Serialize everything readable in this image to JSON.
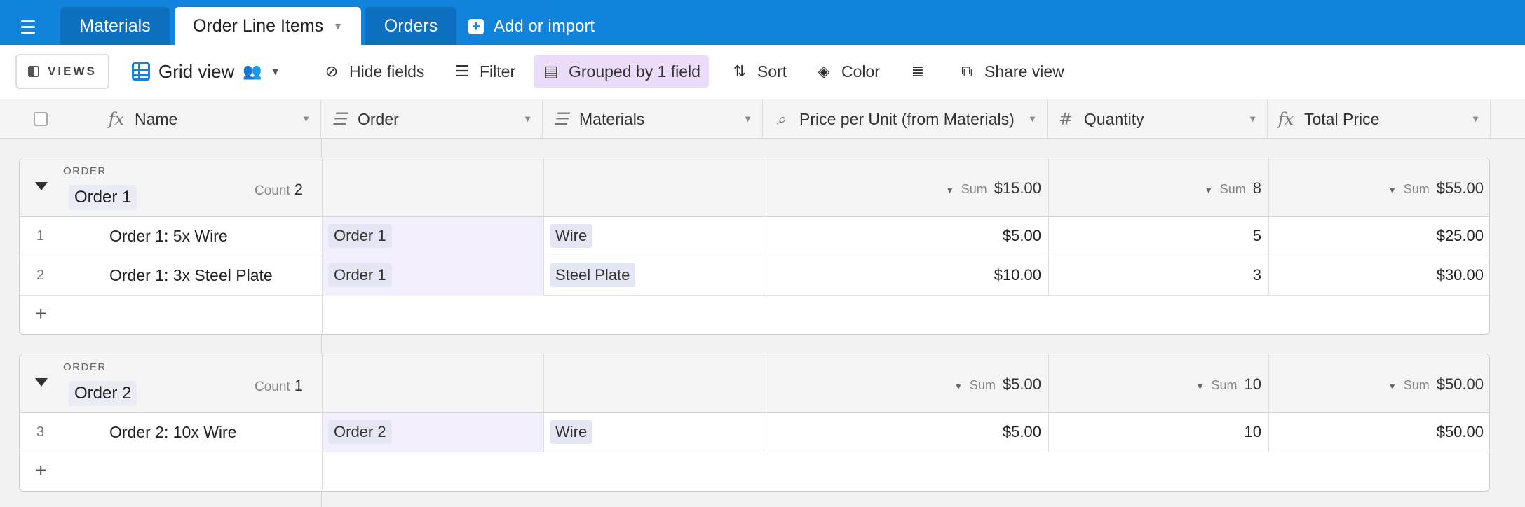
{
  "tabs": [
    {
      "label": "Materials",
      "active": false
    },
    {
      "label": "Order Line Items",
      "active": true
    },
    {
      "label": "Orders",
      "active": false
    }
  ],
  "add_import_label": "Add or import",
  "toolbar": {
    "views_label": "VIEWS",
    "view_name": "Grid view",
    "hide_fields": "Hide fields",
    "filter": "Filter",
    "grouped": "Grouped by 1 field",
    "sort": "Sort",
    "color": "Color",
    "share_view": "Share view"
  },
  "columns": [
    {
      "name": "Name",
      "icon": "formula-icon"
    },
    {
      "name": "Order",
      "icon": "link-field-icon"
    },
    {
      "name": "Materials",
      "icon": "link-field-icon"
    },
    {
      "name": "Price per Unit (from Materials)",
      "icon": "lookup-icon"
    },
    {
      "name": "Quantity",
      "icon": "number-icon"
    },
    {
      "name": "Total Price",
      "icon": "formula-icon"
    }
  ],
  "groups": [
    {
      "field_label": "ORDER",
      "title": "Order 1",
      "count_label": "Count",
      "count": "2",
      "sum_label": "Sum",
      "sum_price_per_unit": "$15.00",
      "sum_quantity": "8",
      "sum_total": "$55.00",
      "rows": [
        {
          "num": "1",
          "name": "Order 1: 5x Wire",
          "order": "Order 1",
          "material": "Wire",
          "price": "$5.00",
          "qty": "5",
          "total": "$25.00"
        },
        {
          "num": "2",
          "name": "Order 1: 3x Steel Plate",
          "order": "Order 1",
          "material": "Steel Plate",
          "price": "$10.00",
          "qty": "3",
          "total": "$30.00"
        }
      ]
    },
    {
      "field_label": "ORDER",
      "title": "Order 2",
      "count_label": "Count",
      "count": "1",
      "sum_label": "Sum",
      "sum_price_per_unit": "$5.00",
      "sum_quantity": "10",
      "sum_total": "$50.00",
      "rows": [
        {
          "num": "3",
          "name": "Order 2: 10x Wire",
          "order": "Order 2",
          "material": "Wire",
          "price": "$5.00",
          "qty": "10",
          "total": "$50.00"
        }
      ]
    }
  ],
  "add_row_symbol": "+",
  "colors": {
    "topbar": "#1283da",
    "grouped_bg": "#ecdcfb",
    "link_cell": "#f3effc"
  }
}
